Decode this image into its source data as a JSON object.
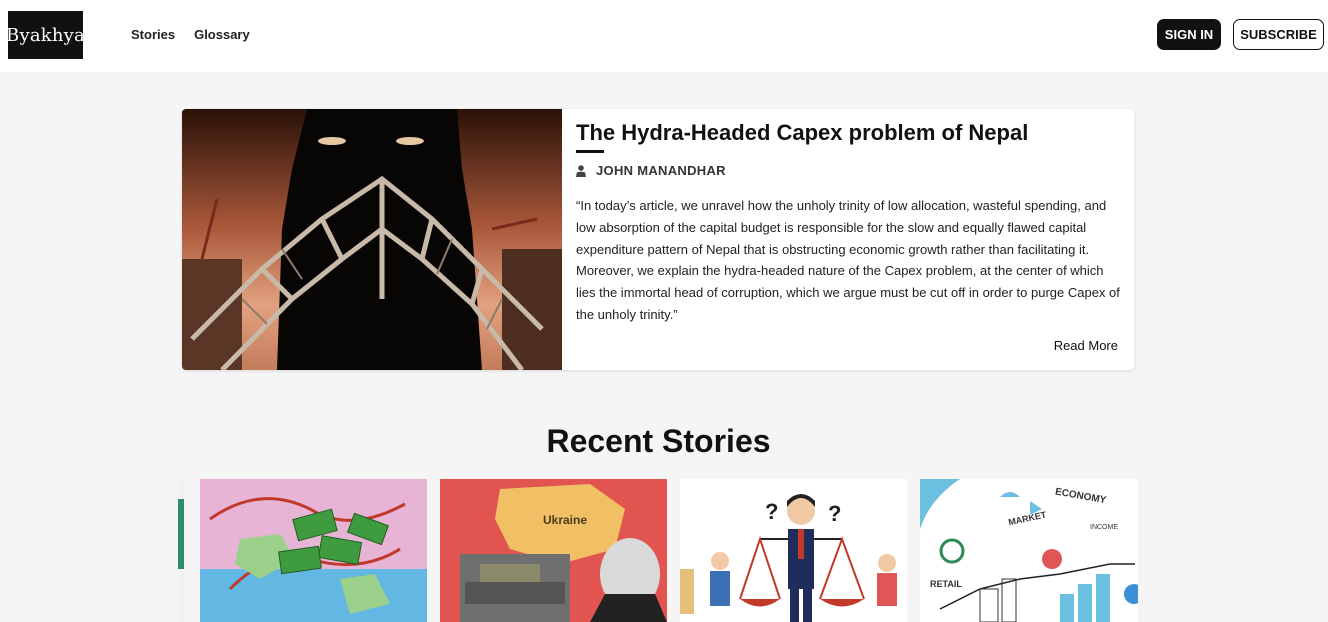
{
  "header": {
    "logo_text": "Byakhya",
    "nav": [
      {
        "label": "Stories"
      },
      {
        "label": "Glossary"
      }
    ],
    "sign_in_label": "SIGN IN",
    "subscribe_label": "SUBSCRIBE"
  },
  "featured": {
    "title": "The Hydra-Headed Capex problem of Nepal",
    "author_icon": "user-icon",
    "author": "JOHN MANANDHAR",
    "excerpt": "“In today’s article, we unravel how the unholy trinity of low allocation, wasteful spending, and low absorption of the capital budget is responsible for the slow and equally flawed capital expenditure pattern of Nepal that is obstructing economic growth rather than facilitating it. Moreover, we explain the hydra-headed nature of the Capex problem, at the center of which lies the immortal head of corruption, which we argue must be cut off in order to purge Capex of the unholy trinity.”",
    "read_more_label": "Read More"
  },
  "recent": {
    "title": "Recent Stories",
    "cards": [
      {
        "image": "remittance-money-map-illustration"
      },
      {
        "image": "ukraine-map-putin-illustration",
        "image_text": "Ukraine"
      },
      {
        "image": "businessman-scales-illustration"
      },
      {
        "image": "economy-market-infographic",
        "image_text_1": "ECONOMY",
        "image_text_2": "MARKET",
        "image_text_3": "RETAIL",
        "image_text_4": "INCOME"
      }
    ]
  },
  "colors": {
    "background": "#f5f5f5",
    "header_bg": "#ffffff",
    "primary_dark": "#111111"
  }
}
